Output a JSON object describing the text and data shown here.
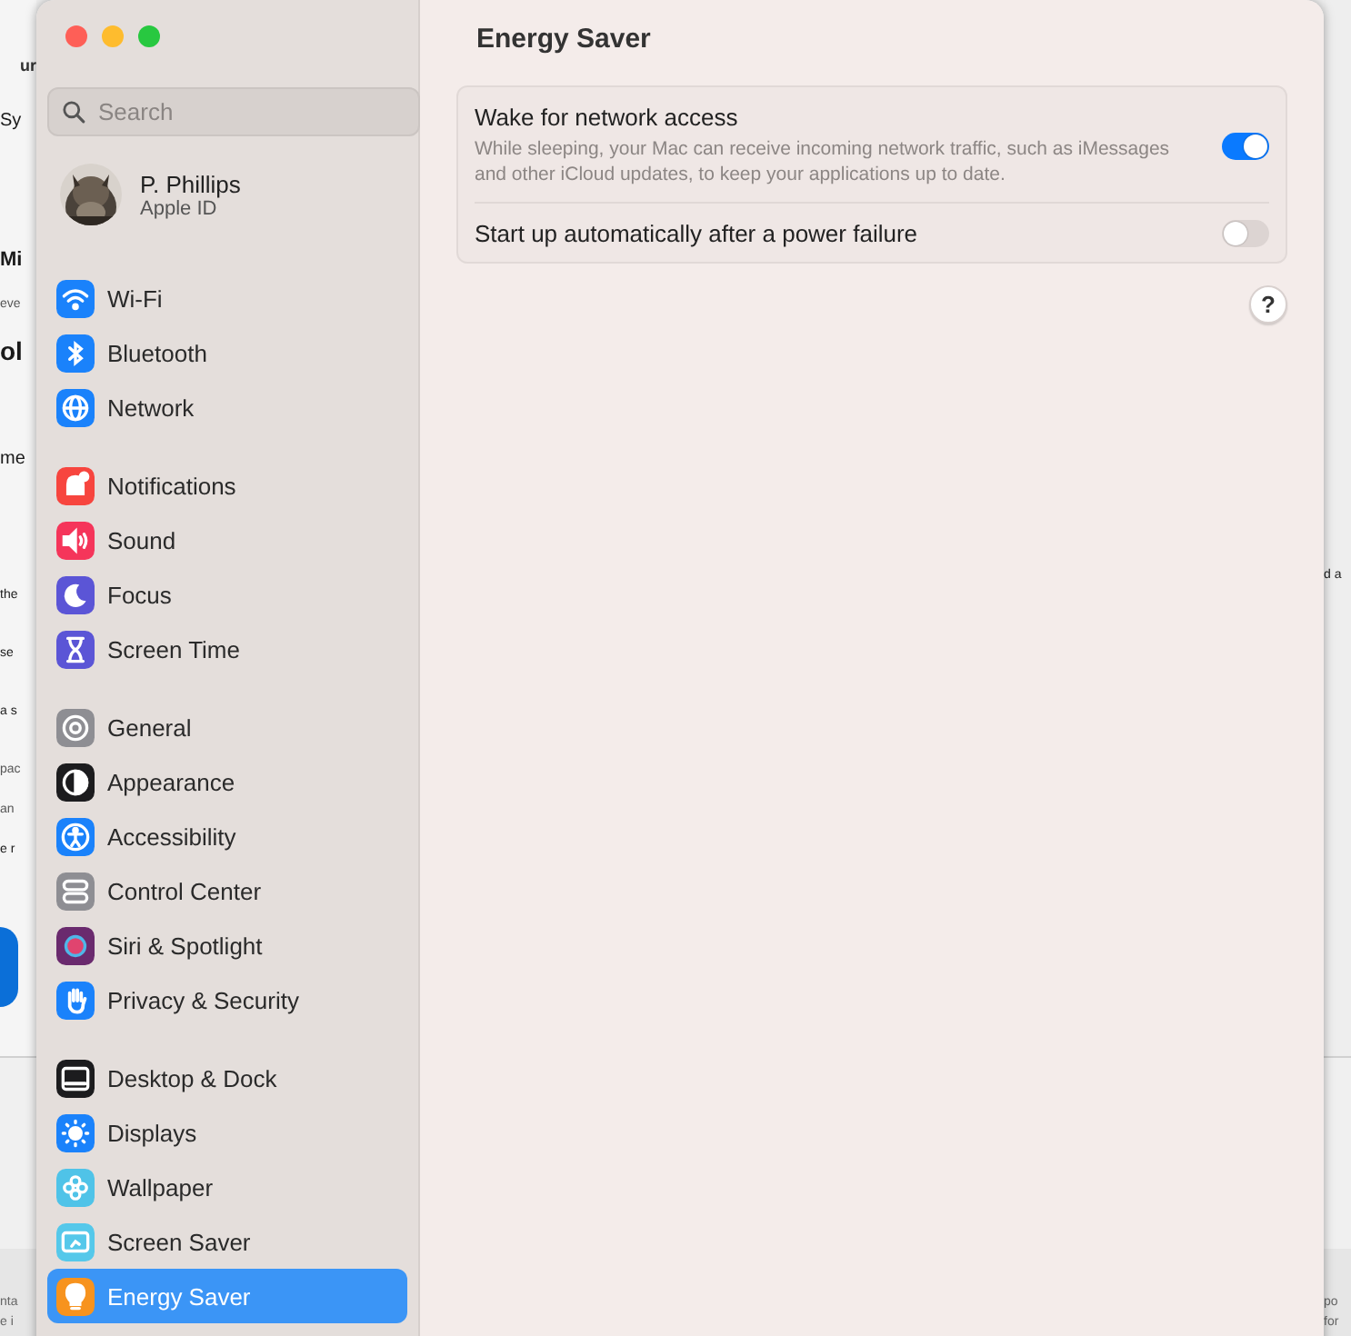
{
  "background": {
    "left_fragments": [
      {
        "text": "ur",
        "kind": "title"
      },
      {
        "text": "Sy",
        "kind": "body"
      },
      {
        "text": "Mi",
        "kind": "heading"
      },
      {
        "text": "eve",
        "kind": "small"
      },
      {
        "text": "ol",
        "kind": "huge"
      },
      {
        "text": "me",
        "kind": "body"
      },
      {
        "text": "the",
        "kind": "large"
      },
      {
        "text": "se",
        "kind": "large"
      },
      {
        "text": "a s",
        "kind": "large"
      },
      {
        "text": "pac",
        "kind": "small"
      },
      {
        "text": "an",
        "kind": "small"
      },
      {
        "text": "e r",
        "kind": "large"
      }
    ],
    "right_fragments": [
      {
        "text": "d a",
        "kind": "large"
      }
    ],
    "footer_left": [
      "nta",
      "e i"
    ],
    "footer_right": [
      "po",
      "for"
    ]
  },
  "window": {
    "title": "Energy Saver",
    "search": {
      "placeholder": "Search"
    },
    "account": {
      "name": "P. Phillips",
      "subtitle": "Apple ID"
    },
    "sidebar_groups": [
      [
        {
          "label": "Wi-Fi",
          "color": "#1a82fb",
          "selected": false
        },
        {
          "label": "Bluetooth",
          "color": "#1a82fb",
          "selected": false
        },
        {
          "label": "Network",
          "color": "#1a82fb",
          "selected": false
        }
      ],
      [
        {
          "label": "Notifications",
          "color": "#f7453e",
          "selected": false
        },
        {
          "label": "Sound",
          "color": "#f5355a",
          "selected": false
        },
        {
          "label": "Focus",
          "color": "#5b55d6",
          "selected": false
        },
        {
          "label": "Screen Time",
          "color": "#5b55d6",
          "selected": false
        }
      ],
      [
        {
          "label": "General",
          "color": "#8e8e93",
          "selected": false
        },
        {
          "label": "Appearance",
          "color": "#1c1c1e",
          "selected": false
        },
        {
          "label": "Accessibility",
          "color": "#1a82fb",
          "selected": false
        },
        {
          "label": "Control Center",
          "color": "#8e8e93",
          "selected": false
        },
        {
          "label": "Siri & Spotlight",
          "color": "#6a2a6e",
          "selected": false
        },
        {
          "label": "Privacy & Security",
          "color": "#1a82fb",
          "selected": false
        }
      ],
      [
        {
          "label": "Desktop & Dock",
          "color": "#1c1c1e",
          "selected": false
        },
        {
          "label": "Displays",
          "color": "#1a82fb",
          "selected": false
        },
        {
          "label": "Wallpaper",
          "color": "#4fc3e8",
          "selected": false
        },
        {
          "label": "Screen Saver",
          "color": "#55c8ea",
          "selected": false
        },
        {
          "label": "Energy Saver",
          "color": "#f7931e",
          "selected": true
        }
      ]
    ],
    "settings": [
      {
        "label": "Wake for network access",
        "description": "While sleeping, your Mac can receive incoming network traffic, such as iMessages and other iCloud updates, to keep your applications up to date.",
        "on": true
      },
      {
        "label": "Start up automatically after a power failure",
        "on": false
      }
    ],
    "help": "?"
  }
}
